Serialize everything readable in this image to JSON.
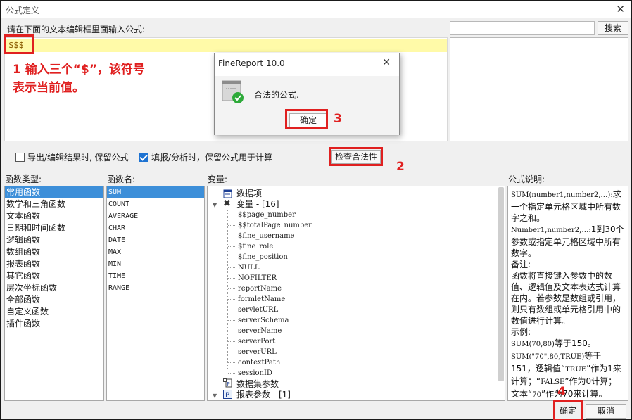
{
  "window": {
    "title": "公式定义"
  },
  "editor": {
    "prompt": "请在下面的文本编辑框里面输入公式:",
    "formula": "$$$",
    "annotation": "1 输入三个“$”，该符号表示当前值。"
  },
  "search": {
    "button": "搜索",
    "value": ""
  },
  "options": {
    "export_keep": {
      "label": "导出/编辑结果时, 保留公式",
      "checked": false
    },
    "fill_keep": {
      "label": "填报/分析时，保留公式用于计算",
      "checked": true
    }
  },
  "check_button": "检查合法性",
  "steps": {
    "s2": "2",
    "s3": "3",
    "s4": "4"
  },
  "panels": {
    "function_type_label": "函数类型:",
    "function_name_label": "函数名:",
    "variable_label": "变量:",
    "description_label": "公式说明:"
  },
  "function_types": [
    "常用函数",
    "数学和三角函数",
    "文本函数",
    "日期和时间函数",
    "逻辑函数",
    "数组函数",
    "报表函数",
    "其它函数",
    "层次坐标函数",
    "全部函数",
    "自定义函数",
    "插件函数"
  ],
  "function_names": [
    "SUM",
    "COUNT",
    "AVERAGE",
    "CHAR",
    "DATE",
    "MAX",
    "MIN",
    "TIME",
    "RANGE"
  ],
  "variables": {
    "data_items": "数据项",
    "variables_group": "变量 - [16]",
    "items": [
      "$$page_number",
      "$$totalPage_number",
      "$fine_username",
      "$fine_role",
      "$fine_position",
      "NULL",
      "NOFILTER",
      "reportName",
      "formletName",
      "servletURL",
      "serverSchema",
      "serverName",
      "serverPort",
      "serverURL",
      "contextPath",
      "sessionID"
    ],
    "dataset_params": "数据集参数",
    "report_params": "报表参数 - [1]"
  },
  "description": {
    "line1": "SUM(number1,number2,…):",
    "line1b": "求一个指定单元格区域中所有数字之和。",
    "line2": "Number1,number2,…:",
    "line2b": "1到30个参数或指定单元格区域中所有数字。",
    "note_label": "备注:",
    "note": "函数将直接键入参数中的数值、逻辑值及文本表达式计算在内。若参数是数组或引用，则只有数组或单元格引用中的数值进行计算。",
    "example_label": "示例:",
    "ex1": "SUM(70,80)",
    "ex1b": "等于150。",
    "ex2": "SUM(\"70\",80,TRUE)",
    "ex2b": "等于151，逻辑值“",
    "ex2c": "TRUE",
    "ex2d": "”作为1来计算；“",
    "ex2e": "FALSE",
    "ex2f": "”作为0计算；文本“",
    "ex2g": "70",
    "ex2h": "”作为70来计算。"
  },
  "footer": {
    "ok": "确定",
    "cancel": "取消"
  },
  "dialog": {
    "title": "FineReport 10.0",
    "message": "合法的公式.",
    "ok": "确定"
  },
  "colors": {
    "annotation": "#e02020",
    "selection": "#3d8fd9",
    "editor_highlight": "#fffaa8"
  }
}
